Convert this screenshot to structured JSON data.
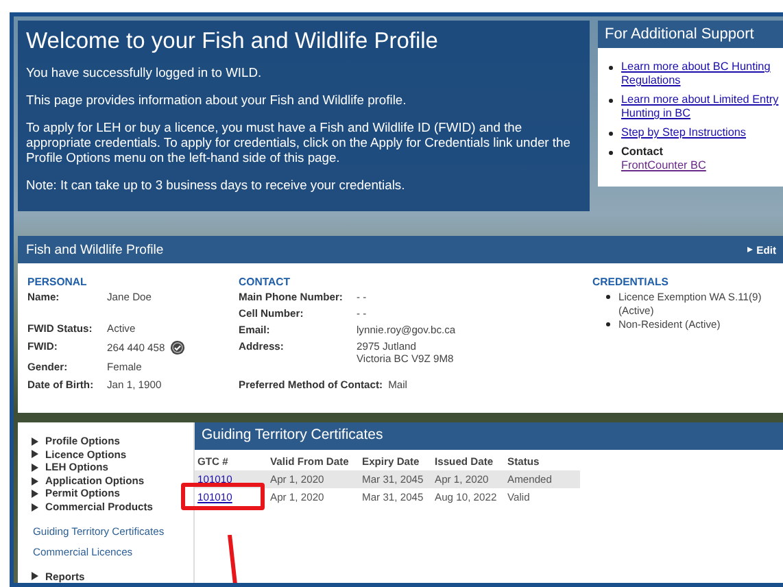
{
  "welcome": {
    "title": "Welcome to your Fish and Wildlife Profile",
    "paragraphs": [
      "You have successfully logged in to WILD.",
      "This page provides information about your Fish and Wildlife profile.",
      "To apply for LEH or buy a licence, you must have a Fish and Wildlife ID (FWID) and the appropriate credentials. To apply for credentials, click on the Apply for Credentials link under the Profile Options menu on the left-hand side of this page.",
      "Note: It can take up to 3 business days to receive your credentials."
    ]
  },
  "support": {
    "title": "For Additional Support",
    "items": [
      {
        "kind": "link",
        "text": "Learn more about BC Hunting Regulations"
      },
      {
        "kind": "link",
        "text": "Learn more about Limited Entry Hunting in BC"
      },
      {
        "kind": "link",
        "text": "Step by Step Instructions"
      },
      {
        "kind": "contact",
        "label": "Contact",
        "text": "FrontCounter BC"
      }
    ]
  },
  "profile": {
    "title": "Fish and Wildlife Profile",
    "edit": "Edit",
    "personal": {
      "heading": "PERSONAL",
      "fields": [
        {
          "label": "Name:",
          "value": "Jane Doe"
        },
        {
          "label": "FWID Status:",
          "value": "Active"
        },
        {
          "label": "FWID:",
          "value": "264 440 458",
          "verified": true
        },
        {
          "label": "Gender:",
          "value": "Female"
        },
        {
          "label": "Date of Birth:",
          "value": "Jan 1, 1900"
        }
      ]
    },
    "contact": {
      "heading": "CONTACT",
      "fields": [
        {
          "label": "Main Phone Number:",
          "lines": [
            "- -"
          ]
        },
        {
          "label": "Cell Number:",
          "lines": [
            "- -"
          ]
        },
        {
          "label": "Email:",
          "lines": [
            "lynnie.roy@gov.bc.ca"
          ]
        },
        {
          "label": "Address:",
          "lines": [
            "2975 Jutland",
            "Victoria BC V9Z 9M8"
          ]
        }
      ],
      "preferred": {
        "label": "Preferred Method of Contact:",
        "value": "Mail"
      }
    },
    "credentials": {
      "heading": "CREDENTIALS",
      "items": [
        "Licence Exemption WA S.11(9) (Active)",
        "Non-Resident (Active)"
      ]
    }
  },
  "menu": {
    "groups": [
      {
        "label": "Profile Options",
        "expanded": false
      },
      {
        "label": "Licence Options",
        "expanded": false
      },
      {
        "label": "LEH Options",
        "expanded": false
      },
      {
        "label": "Application Options",
        "expanded": false
      },
      {
        "label": "Permit Options",
        "expanded": false
      },
      {
        "label": "Commercial Products",
        "expanded": false
      }
    ],
    "links": [
      "Guiding Territory Certificates",
      "Commercial Licences"
    ],
    "bottom_groups": [
      {
        "label": "Reports",
        "expanded": false
      }
    ]
  },
  "gtc": {
    "title": "Guiding Territory Certificates",
    "columns": [
      "GTC #",
      "Valid From Date",
      "Expiry Date",
      "Issued Date",
      "Status"
    ],
    "rows": [
      {
        "cells": [
          "101010",
          "Apr 1, 2020",
          "Mar 31, 2045",
          "Apr 1, 2020",
          "Amended"
        ],
        "highlighted": false
      },
      {
        "cells": [
          "101010",
          "Apr 1, 2020",
          "Mar 31, 2045",
          "Aug 10, 2022",
          "Valid"
        ],
        "highlighted": true
      }
    ]
  }
}
